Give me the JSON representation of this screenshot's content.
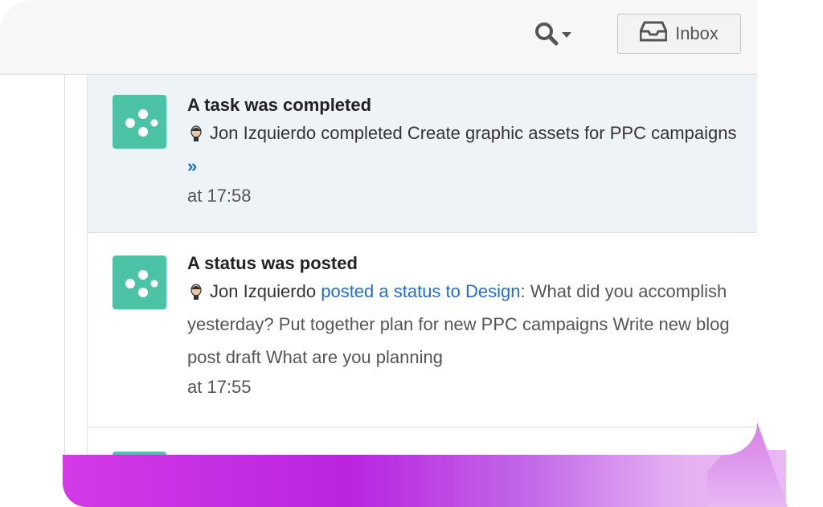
{
  "topbar": {
    "search_icon": "search-icon",
    "dropdown_icon": "caret-down-icon",
    "inbox_label": "Inbox",
    "inbox_icon": "inbox-tray-icon"
  },
  "feed": [
    {
      "title": "A task was completed",
      "user": "Jon Izquierdo",
      "text": "completed Create graphic assets for PPC campaigns",
      "more": "»",
      "time": "at 17:58",
      "highlight": true
    },
    {
      "title": "A status was posted",
      "user": "Jon Izquierdo",
      "link_text": "posted a status to Design",
      "text": ": What did you accomplish yesterday? Put together plan for new PPC campaigns Write new blog post draft What are you planning",
      "time": "at 17:55",
      "highlight": false
    }
  ],
  "colors": {
    "app_icon": "#4cc3a7",
    "link": "#1e6fcf",
    "highlight_bg": "#eef3f8",
    "accent_purple": "#b925e0"
  }
}
